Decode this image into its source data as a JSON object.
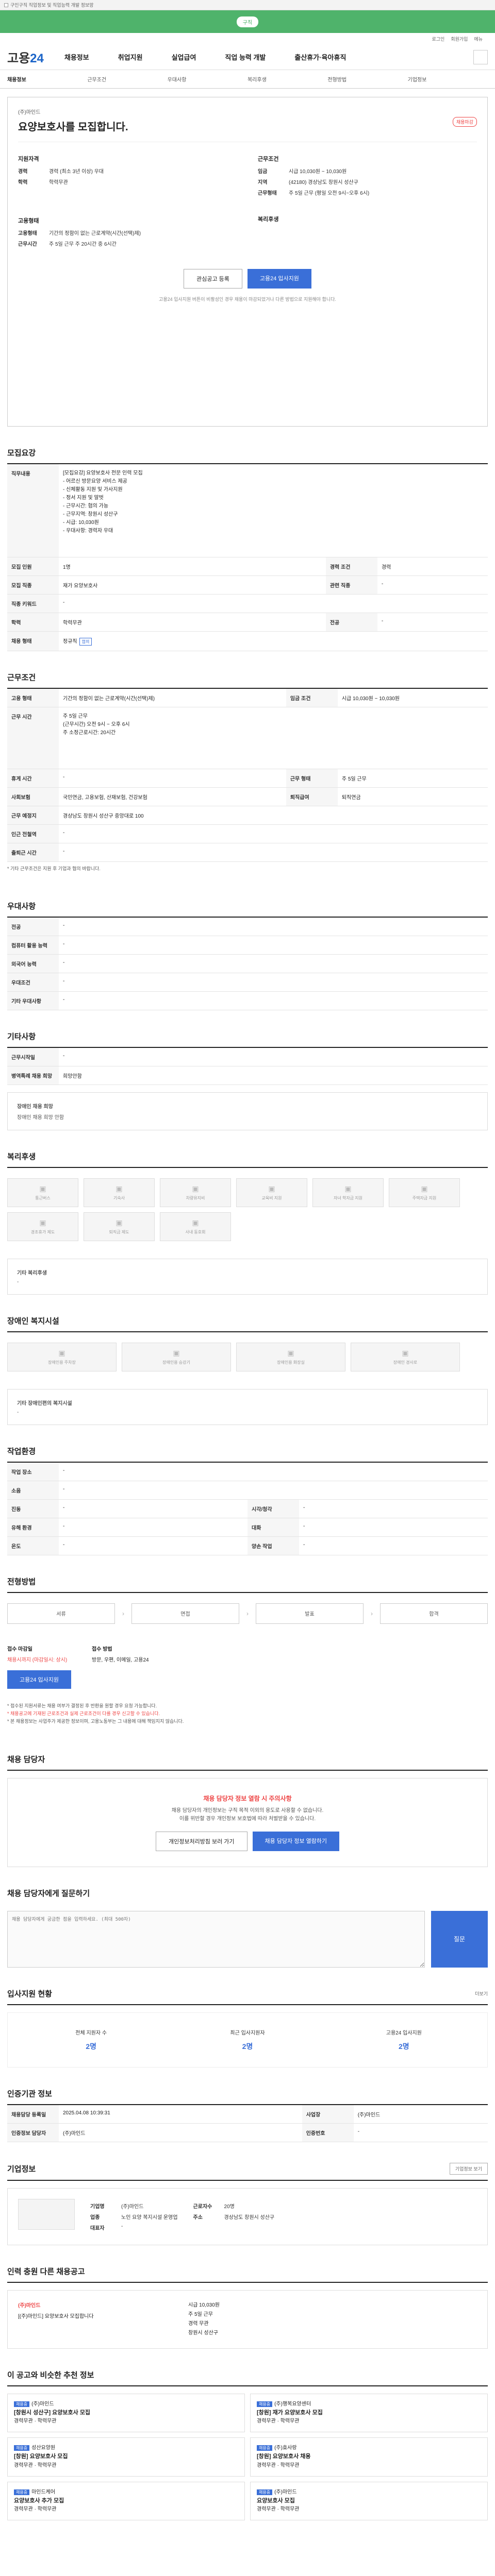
{
  "topbar": {
    "text": "구인구직 직업정보 및 직업능력 개발 정보망"
  },
  "gbar": {
    "pill": "구직"
  },
  "util": [
    "로그인",
    "회원가입",
    "메뉴"
  ],
  "logo": {
    "a": "고용",
    "b": "24"
  },
  "gnb": [
    "채용정보",
    "취업지원",
    "실업급여",
    "직업 능력 개발",
    "출산휴가·육아휴직"
  ],
  "lnb": [
    "채용정보",
    "근무조건",
    "우대사항",
    "복리후생",
    "전형방법",
    "기업정보"
  ],
  "hero": {
    "comp": "(주)마인드",
    "title": "요양보호사를 모집합니다.",
    "badge": "채용마감",
    "left_head": "지원자격",
    "edu_k": "경력",
    "edu_v": "경력 (최소 3년 이상) 우대",
    "career_k": "학력",
    "career_v": "학력무관",
    "right_head": "근무조건",
    "wage_k": "임금",
    "wage_v": "시급 10,030원 ~ 10,030원",
    "region_k": "지역",
    "region_v": "(42180) 경상남도 창원시 성산구",
    "type_k": "근무형태",
    "type_v": "주 5일 근무 (평일 오전 9시~오후 6시)",
    "left2_head": "고용형태",
    "emp_k": "고용형태",
    "emp_v": "기간의 정함이 없는 근로계약(시간(선택)제)",
    "hours_k": "근무시간",
    "hours_v": "주 5일 근무 주 20시간 중 6시간",
    "right2_head": "복리후생",
    "btn_scrap": "관심공고 등록",
    "btn_apply": "고용24 입사지원",
    "note": "고용24 입사지원 버튼이 비활성인 경우 채용이 마감되었거나 다른 방법으로 지원해야 합니다."
  },
  "sec1": {
    "title": "모집요강",
    "rows": [
      {
        "k": "직무내용",
        "v": "[모집요강] 요양보호사 전문 인력 모집\n- 어르신 방문요양 서비스 제공\n- 신체활동 지원 및 가사지원\n- 정서 지원 및 말벗\n- 근무시간: 협의 가능\n- 근무지역: 창원시 성산구\n- 시급: 10,030원\n- 우대사항: 경력자 우대"
      },
      {
        "k": "모집 인원",
        "v": "1명",
        "k2": "경력 조건",
        "v2": "경력"
      },
      {
        "k": "모집 직종",
        "v": "재가 요양보호사",
        "k2": "관련 직종",
        "v2": "-"
      },
      {
        "k": "직종 키워드",
        "v": "-",
        "k2": "",
        "v2": ""
      },
      {
        "k": "학력",
        "v": "학력무관",
        "k2": "전공",
        "v2": "-"
      },
      {
        "k": "채용 형태",
        "v": "정규직",
        "tag": "협의",
        "k2": "",
        "v2": ""
      }
    ]
  },
  "sec2": {
    "title": "근무조건",
    "rows": [
      {
        "k": "고용 형태",
        "v": "기간의 정함이 없는 근로계약(시간(선택)제)",
        "k2": "임금 조건",
        "v2": "시급 10,030원 ~ 10,030원"
      },
      {
        "k": "근무 시간",
        "v": "주 5일 근무\n(근무시간) 오전 9시 ~ 오후 6시\n주 소정근로시간: 20시간"
      },
      {
        "k": "휴게 시간",
        "v": "-",
        "k2": "근무 형태",
        "v2": "주 5일 근무"
      },
      {
        "k": "사회보험",
        "v": "국민연금, 고용보험, 산재보험, 건강보험",
        "k2": "퇴직급여",
        "v2": "퇴직연금"
      },
      {
        "k": "근무 예정지",
        "v": "경상남도 창원시 성산구 중앙대로 100",
        "k2": "",
        "v2": ""
      },
      {
        "k": "인근 전철역",
        "v": "-",
        "k2": "",
        "v2": ""
      },
      {
        "k": "출퇴근 시간",
        "v": "-",
        "k2": "",
        "v2": ""
      }
    ],
    "foot": "* 기타 근무조건은 지원 후 기업과 협의 바랍니다."
  },
  "sec3": {
    "title": "우대사항",
    "rows": [
      {
        "k": "전공",
        "v": "-"
      },
      {
        "k": "컴퓨터 활용 능력",
        "v": "-"
      },
      {
        "k": "외국어 능력",
        "v": "-"
      },
      {
        "k": "우대조건",
        "v": "-"
      },
      {
        "k": "기타 우대사항",
        "v": "-"
      }
    ]
  },
  "sec4": {
    "title": "기타사항",
    "rows": [
      {
        "k": "근무시작일",
        "v": "-"
      },
      {
        "k": "병역특례 채용 희망",
        "v": "희망안함"
      }
    ],
    "box_k": "장애인 채용 희망",
    "box_v": "장애인 채용 희망 안함"
  },
  "sec5": {
    "title": "복리후생",
    "items": [
      "통근버스",
      "기숙사",
      "차량유지비",
      "교육비 지원",
      "자녀 학자금 지원",
      "주택자금 지원",
      "경조휴가 제도",
      "퇴직금 제도",
      "사내 동호회"
    ],
    "other_k": "기타 복리후생",
    "other_v": "-"
  },
  "sec6": {
    "title": "장애인 복지시설",
    "items": [
      "장애인용 주차장",
      "장애인용 승강기",
      "장애인용 화장실",
      "장애인 경사로"
    ],
    "other_k": "기타 장애인편의 복지시설",
    "other_v": "-"
  },
  "sec7": {
    "title": "작업환경",
    "rows": [
      {
        "k": "작업 장소",
        "v": "-",
        "k2": "",
        "v2": ""
      },
      {
        "k": "소음",
        "v": "-",
        "k2": "",
        "v2": ""
      },
      {
        "k": "진동",
        "v": "-",
        "k2": "시각/청각",
        "v2": "-"
      },
      {
        "k": "유해 환경",
        "v": "-",
        "k2": "대화",
        "v2": "-"
      },
      {
        "k": "온도",
        "v": "-",
        "k2": "양손 작업",
        "v2": "-"
      }
    ]
  },
  "sec8": {
    "title": "전형방법",
    "steps": [
      "서류",
      "면접",
      "발표",
      "합격"
    ],
    "apply_k": "접수 마감일",
    "apply_v": "채용시까지 (마감일시: 상시)",
    "method_k": "접수 방법",
    "method_v": "방문, 우편, 이메일, 고용24",
    "btn": "고용24 입사지원",
    "notes": [
      "* 접수된 지원서류는 채용 여부가 결정된 후 반환을 원할 경우 요청 가능합니다.",
      "* 채용공고에 기재된 근로조건과 실제 근로조건이 다를 경우 신고할 수 있습니다.",
      "* 본 채용정보는 사업주가 제공한 정보이며, 고용노동부는 그 내용에 대해 책임지지 않습니다."
    ]
  },
  "sec9": {
    "title": "채용 담당자",
    "warn_t": "채용 담당자 정보 열람 시 주의사항",
    "warn_p": "채용 담당자의 개인정보는 구직 목적 이외의 용도로 사용할 수 없습니다.\n이를 위반할 경우 개인정보 보호법에 따라 처벌받을 수 있습니다.",
    "btn1": "개인정보처리방침 보러 가기",
    "btn2": "채용 담당자 정보 열람하기"
  },
  "sec10": {
    "title": "채용 담당자에게 질문하기",
    "placeholder": "채용 담당자에게 궁금한 점을 입력하세요. (최대 500자)",
    "go": "질문"
  },
  "sec11": {
    "title": "입사지원 현황",
    "more": "더보기",
    "stats": [
      {
        "k": "전체 지원자 수",
        "v": "2명"
      },
      {
        "k": "최근 입사지원자",
        "v": "2명"
      },
      {
        "k": "고용24 입사지원",
        "v": "2명"
      }
    ]
  },
  "sec12": {
    "title": "인증기관 정보",
    "rows": [
      {
        "k": "채용담당 등록일",
        "v": "2025.04.08 10:39:31",
        "k2": "사업장",
        "v2": "(주)마인드"
      },
      {
        "k": "인증정보 담당자",
        "v": "(주)마인드",
        "k2": "인증번호",
        "v2": "-"
      }
    ]
  },
  "sec13": {
    "title": "기업정보",
    "btn": "기업정보 보기",
    "rows": [
      {
        "k": "기업명",
        "v": "(주)마인드"
      },
      {
        "k": "업종",
        "v": "노인 요양 복지시설 운영업"
      },
      {
        "k": "대표자",
        "v": "-"
      },
      {
        "k": "근로자수",
        "v": "20명"
      },
      {
        "k": "주소",
        "v": "경상남도 창원시 성산구"
      }
    ]
  },
  "sec14": {
    "title": "인력 충원 다른 채용공고",
    "comp": "(주)마인드",
    "job": "[(주)마인드] 요양보호사 모집합니다",
    "info": [
      "시급 10,030원",
      "주 5일 근무",
      "경력 무관",
      "창원시 성산구"
    ]
  },
  "sec15": {
    "title": "이 공고와 비슷한 추천 정보",
    "label": "채용중",
    "cards": [
      {
        "c": "(주)마인드",
        "t": "[창원시 성산구] 요양보호사 모집",
        "d": "경력무관 · 학력무관"
      },
      {
        "c": "(주)행복요양센터",
        "t": "[창원] 재가 요양보호사 모집",
        "d": "경력무관 · 학력무관"
      },
      {
        "c": "성산요양원",
        "t": "[창원] 요양보호사 모집",
        "d": "경력무관 · 학력무관"
      },
      {
        "c": "(주)효사랑",
        "t": "[창원] 요양보호사 채용",
        "d": "경력무관 · 학력무관"
      },
      {
        "c": "마인드케어",
        "t": "요양보호사 추가 모집",
        "d": "경력무관 · 학력무관"
      },
      {
        "c": "(주)마인드",
        "t": "요양보호사 모집",
        "d": "경력무관 · 학력무관"
      }
    ]
  }
}
